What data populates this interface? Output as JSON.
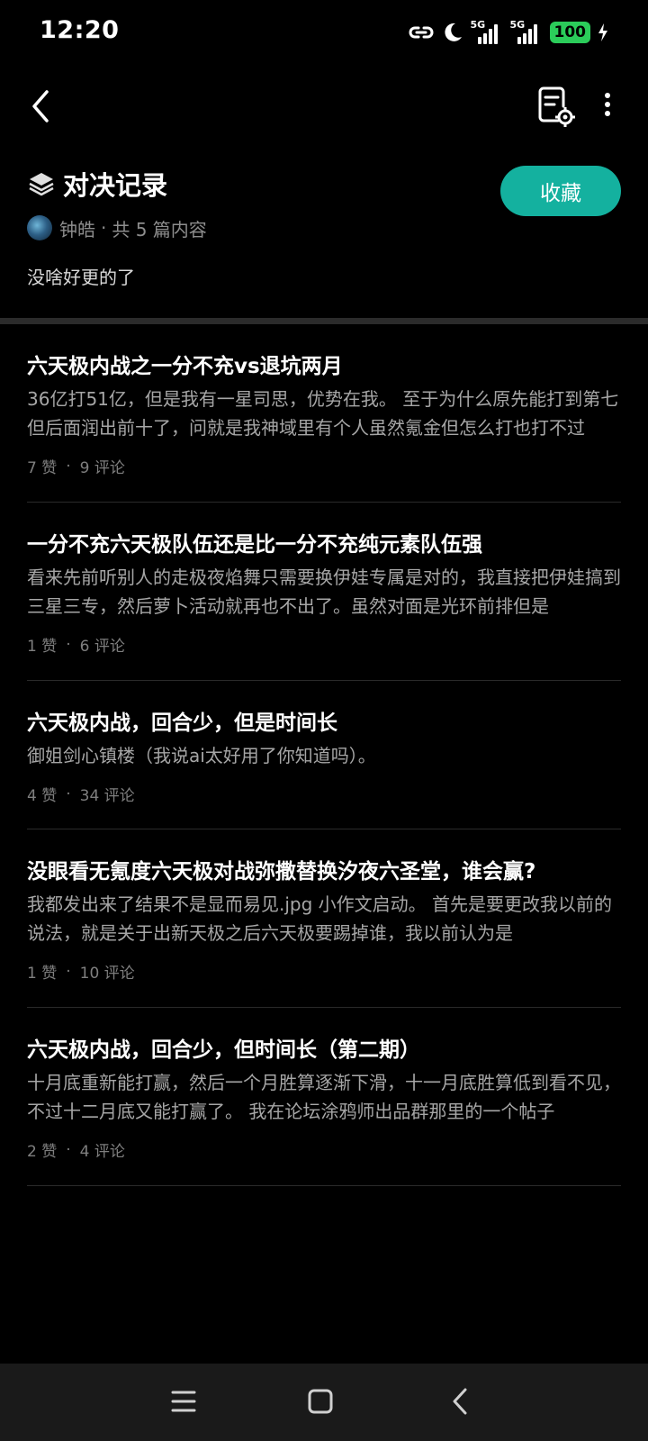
{
  "status_bar": {
    "time": "12:20",
    "signal1_label": "5G",
    "signal2_label": "5G",
    "battery": "100",
    "icons": [
      "link-icon",
      "moon-icon",
      "signal-5g-icon",
      "signal-5g-icon",
      "battery-icon",
      "charging-icon"
    ]
  },
  "toolbar": {
    "icons": [
      "back-icon",
      "document-settings-icon",
      "more-icon"
    ]
  },
  "collection": {
    "title": "对决记录",
    "follow_label": "收藏",
    "author": "钟皓",
    "separator": "·",
    "count_text": "共 5 篇内容",
    "description": "没啥好更的了"
  },
  "posts": [
    {
      "title": "六天极内战之一分不充vs退坑两月",
      "excerpt": "36亿打51亿，但是我有一星司思，优势在我。 至于为什么原先能打到第七但后面润出前十了，问就是我神域里有个人虽然氪金但怎么打也打不过",
      "likes": "7 赞",
      "comments": "9 评论"
    },
    {
      "title": "一分不充六天极队伍还是比一分不充纯元素队伍强",
      "excerpt": "看来先前听别人的走极夜焰舞只需要换伊娃专属是对的，我直接把伊娃搞到三星三专，然后萝卜活动就再也不出了。虽然对面是光环前排但是",
      "likes": "1 赞",
      "comments": "6 评论"
    },
    {
      "title": "六天极内战，回合少，但是时间长",
      "excerpt": "御姐剑心镇楼（我说ai太好用了你知道吗）。",
      "likes": "4 赞",
      "comments": "34 评论"
    },
    {
      "title": "没眼看无氪度六天极对战弥撒替换汐夜六圣堂，谁会赢?",
      "excerpt": "我都发出来了结果不是显而易见.jpg 小作文启动。 首先是要更改我以前的说法，就是关于出新天极之后六天极要踢掉谁，我以前认为是",
      "likes": "1 赞",
      "comments": "10 评论"
    },
    {
      "title": "六天极内战，回合少，但时间长（第二期）",
      "excerpt": "十月底重新能打赢，然后一个月胜算逐渐下滑，十一月底胜算低到看不见，不过十二月底又能打赢了。 我在论坛涂鸦师出品群那里的一个帖子",
      "likes": "2 赞",
      "comments": "4 评论"
    }
  ],
  "meta_separator": "·",
  "nav_bar": {
    "icons": [
      "menu-icon",
      "home-icon",
      "back-icon"
    ]
  },
  "colors": {
    "background": "#000000",
    "accent": "#14b19f",
    "battery": "#2bcc5a",
    "divider": "#2a2a2a"
  }
}
